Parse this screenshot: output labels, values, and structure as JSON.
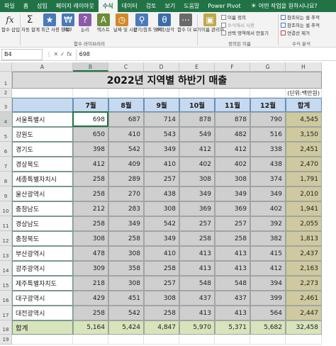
{
  "ribbon": {
    "tabs": [
      "파일",
      "홈",
      "삽입",
      "페이지 레이아웃",
      "수식",
      "데이터",
      "검토",
      "보기",
      "도움말",
      "Power Pivot"
    ],
    "active_tab": "수식",
    "tell_me": "어떤 작업을 원하시나요?",
    "buttons": {
      "insert_function": "함수 삽입",
      "autosum": "자동 합계",
      "recent": "최근 사용 항목",
      "financial": "재무",
      "logical": "논리",
      "text": "텍스트",
      "datetime": "날짜 및 시간",
      "lookup": "찾기/참조 영역",
      "math": "수학/삼각",
      "more": "함수 더 보기",
      "name_manager": "이름 관리자",
      "define_name": "이름 정의",
      "use_in_formula": "수식에서 사용",
      "create_from_selection": "선택 영역에서 만들기",
      "trace_precedents": "참조되는 셀 추적",
      "trace_dependents": "참조하는 셀 추적",
      "remove_arrows": "연결선 제거"
    },
    "groups": {
      "library": "함수 라이브러리",
      "names": "정의된 이름",
      "auditing": "수식 분석"
    }
  },
  "formula_bar": {
    "name_box": "B4",
    "formula": "698",
    "fx": "fx"
  },
  "sheet": {
    "columns": [
      "A",
      "B",
      "C",
      "D",
      "E",
      "F",
      "G",
      "H"
    ],
    "rows": [
      "1",
      "2",
      "3",
      "4",
      "5",
      "6",
      "7",
      "8",
      "9",
      "10",
      "11",
      "12",
      "13",
      "14",
      "15",
      "16",
      "17",
      "18",
      "19"
    ],
    "title": "2022년 지역별 하반기 매출",
    "unit": "(단위:백만원)",
    "headers": [
      "7월",
      "8월",
      "9월",
      "10월",
      "11월",
      "12월",
      "합계"
    ],
    "regions": [
      "서울특별시",
      "강원도",
      "경기도",
      "경상북도",
      "세종특별자치시",
      "울산광역시",
      "충청남도",
      "경상남도",
      "충청북도",
      "부산광역시",
      "광주광역시",
      "제주특별자치도",
      "대구광역시",
      "대전광역시"
    ],
    "values": [
      [
        "698",
        "687",
        "714",
        "878",
        "878",
        "790",
        "4,545"
      ],
      [
        "650",
        "410",
        "543",
        "549",
        "482",
        "516",
        "3,150"
      ],
      [
        "398",
        "542",
        "349",
        "412",
        "412",
        "338",
        "2,451"
      ],
      [
        "412",
        "409",
        "410",
        "402",
        "402",
        "438",
        "2,470"
      ],
      [
        "258",
        "289",
        "257",
        "308",
        "308",
        "374",
        "1,791"
      ],
      [
        "258",
        "270",
        "438",
        "349",
        "349",
        "349",
        "2,010"
      ],
      [
        "212",
        "283",
        "308",
        "369",
        "369",
        "402",
        "1,941"
      ],
      [
        "258",
        "349",
        "542",
        "257",
        "257",
        "392",
        "2,055"
      ],
      [
        "308",
        "258",
        "349",
        "258",
        "258",
        "382",
        "1,813"
      ],
      [
        "478",
        "308",
        "410",
        "413",
        "413",
        "415",
        "2,437"
      ],
      [
        "309",
        "358",
        "258",
        "413",
        "413",
        "412",
        "2,163"
      ],
      [
        "218",
        "308",
        "257",
        "548",
        "548",
        "394",
        "2,273"
      ],
      [
        "429",
        "451",
        "308",
        "437",
        "437",
        "399",
        "2,461"
      ],
      [
        "258",
        "542",
        "258",
        "413",
        "413",
        "564",
        "2,447"
      ]
    ],
    "sum_label": "합계",
    "sums": [
      "5,164",
      "5,424",
      "4,847",
      "5,970",
      "5,371",
      "5,682",
      "32,458"
    ]
  }
}
